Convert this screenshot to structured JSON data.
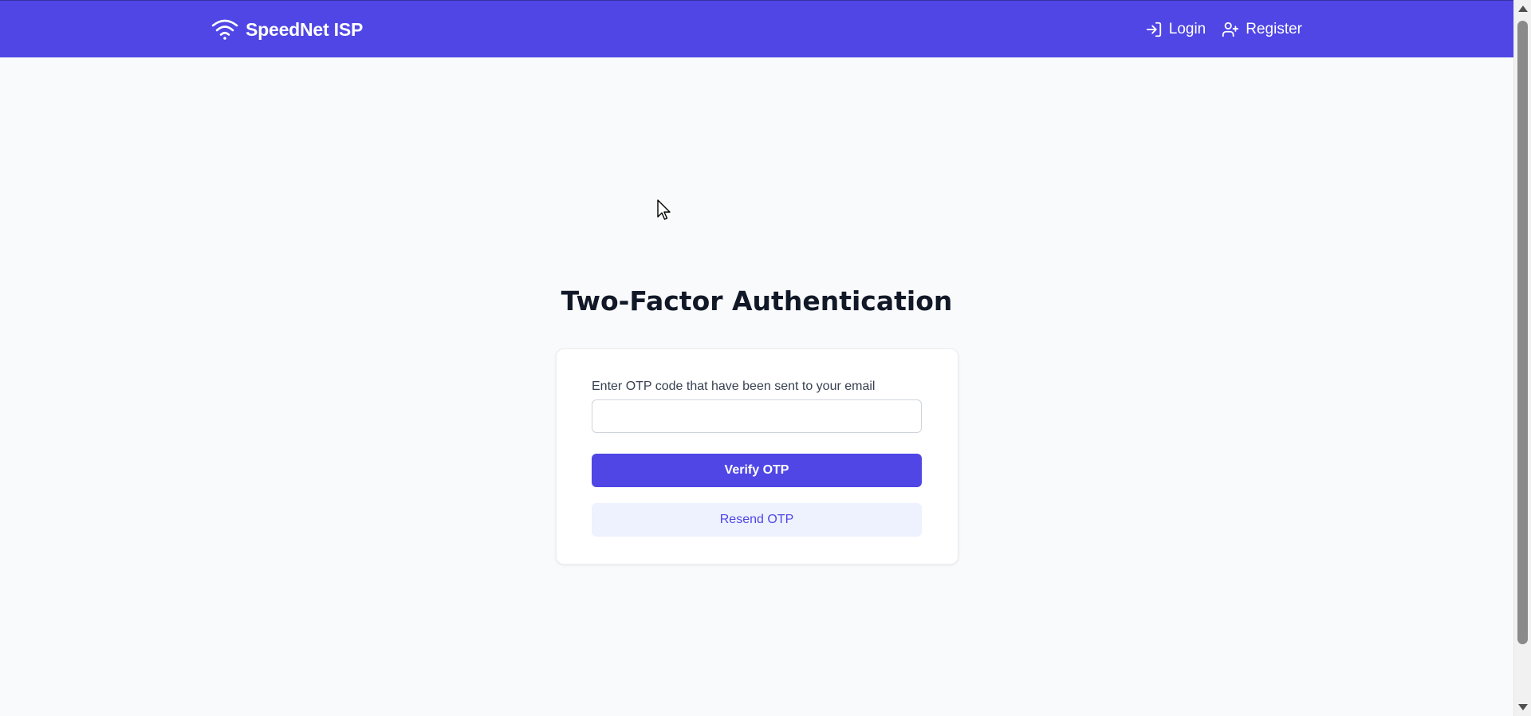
{
  "navbar": {
    "brand_icon": "wifi-icon",
    "brand_name": "SpeedNet ISP",
    "links": [
      {
        "label": "Login",
        "icon": "login-icon"
      },
      {
        "label": "Register",
        "icon": "user-plus-icon"
      }
    ],
    "color": "#4f46e5"
  },
  "main": {
    "title": "Two-Factor Authentication",
    "form": {
      "otp_label": "Enter OTP code that have been sent to your email",
      "otp_value": "",
      "otp_placeholder": "",
      "verify_label": "Verify OTP",
      "resend_label": "Resend OTP"
    }
  },
  "colors": {
    "accent": "#4f46e5",
    "background": "#f9fafb",
    "resend_bg": "#eef2ff",
    "heading": "#111827"
  }
}
